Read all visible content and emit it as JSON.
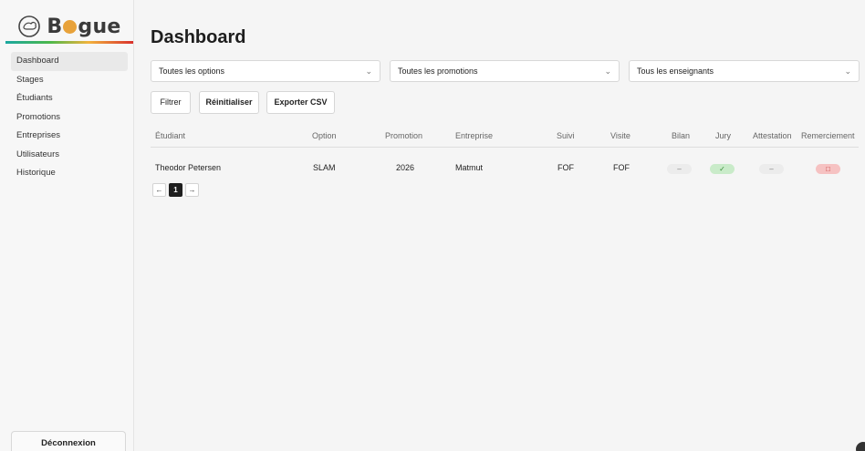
{
  "app": {
    "name_part1": "B",
    "name_part2": "gue"
  },
  "sidebar": {
    "items": [
      {
        "label": "Dashboard",
        "active": true
      },
      {
        "label": "Stages"
      },
      {
        "label": "Étudiants"
      },
      {
        "label": "Promotions"
      },
      {
        "label": "Entreprises"
      },
      {
        "label": "Utilisateurs"
      },
      {
        "label": "Historique"
      }
    ],
    "logout_label": "Déconnexion"
  },
  "page": {
    "title": "Dashboard"
  },
  "filters": {
    "option": "Toutes les options",
    "promotion": "Toutes les promotions",
    "enseignant": "Tous les enseignants"
  },
  "buttons": {
    "filter": "Filtrer",
    "reset": "Réinitialiser",
    "export": "Exporter CSV"
  },
  "table": {
    "headers": [
      "Étudiant",
      "Option",
      "Promotion",
      "Entreprise",
      "Suivi",
      "Visite",
      "Bilan",
      "Jury",
      "Attestation",
      "Remerciement"
    ],
    "rows": [
      {
        "etudiant": "Theodor Petersen",
        "option": "SLAM",
        "promotion": "2026",
        "entreprise": "Matmut",
        "suivi": "FOF",
        "visite": "FOF",
        "bilan": "–",
        "jury": "✓",
        "attestation": "–",
        "remerciement": "□"
      }
    ]
  },
  "pagination": {
    "prev": "←",
    "current": "1",
    "next": "→"
  },
  "colors": {
    "active_nav": "#e9e9e9",
    "pill_green": "#c9ebc9",
    "pill_red": "#f6c2c2",
    "pill_grey": "#ececec"
  }
}
